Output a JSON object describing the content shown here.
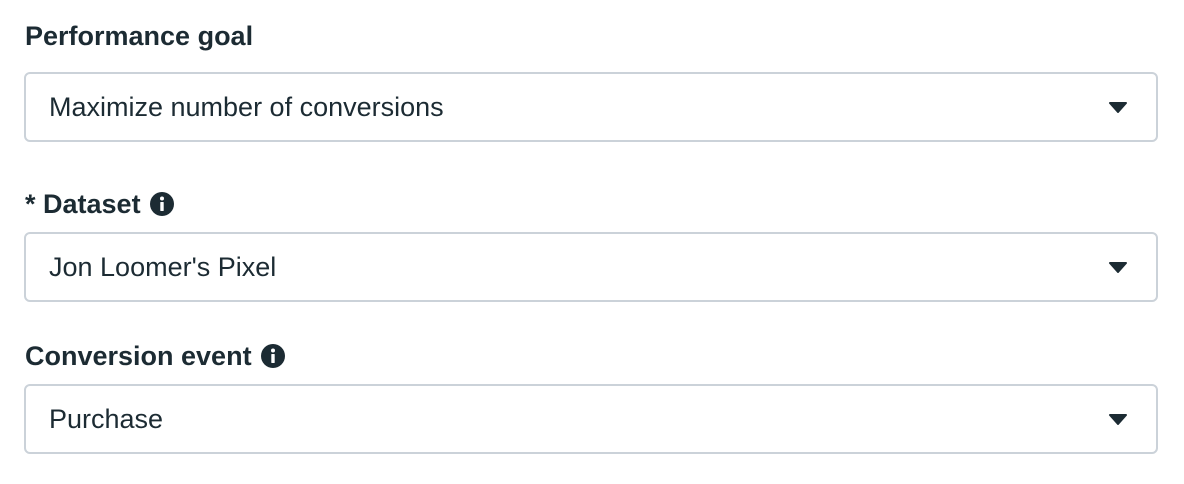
{
  "performance_goal": {
    "label": "Performance goal",
    "value": "Maximize number of conversions",
    "icon": "chevron-down-icon"
  },
  "dataset": {
    "label": "* Dataset",
    "info_icon": "info-icon",
    "value": "Jon Loomer's Pixel",
    "icon": "chevron-down-icon"
  },
  "conversion_event": {
    "label": "Conversion event",
    "info_icon": "info-icon",
    "value": "Purchase",
    "icon": "chevron-down-icon"
  },
  "colors": {
    "text": "#1c2b33",
    "border": "#cbd2d9",
    "background": "#ffffff"
  }
}
